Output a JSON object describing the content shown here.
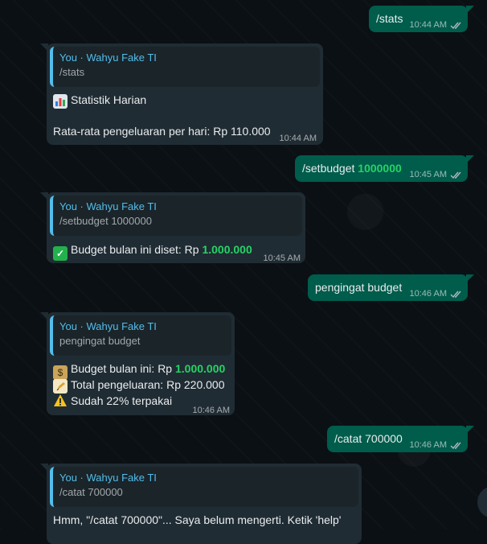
{
  "chat": {
    "messages": [
      {
        "id": "m1",
        "dir": "out",
        "text": "/stats",
        "time": "10:44 AM"
      },
      {
        "id": "m2",
        "dir": "in",
        "quote_author": "You · Wahyu Fake TI",
        "quote_text": "/stats",
        "lines": [
          "Statistik Harian",
          "Rata-rata pengeluaran per hari: Rp 110.000"
        ],
        "emojis": [
          "bar-chart-icon"
        ],
        "time": "10:44 AM"
      },
      {
        "id": "m3",
        "dir": "out",
        "text": "/setbudget ",
        "text_highlight": "1000000",
        "time": "10:45 AM"
      },
      {
        "id": "m4",
        "dir": "in",
        "quote_author": "You · Wahyu Fake TI",
        "quote_text": "/setbudget 1000000",
        "line_prefix": "Budget bulan ini diset: Rp ",
        "line_highlight": "1.000.000",
        "emojis": [
          "check-mark-icon"
        ],
        "time": "10:45 AM"
      },
      {
        "id": "m5",
        "dir": "out",
        "text": "pengingat budget",
        "time": "10:46 AM"
      },
      {
        "id": "m6",
        "dir": "in",
        "quote_author": "You · Wahyu Fake TI",
        "quote_text": "pengingat budget",
        "line1_prefix": "Budget bulan ini: Rp ",
        "line1_highlight": "1.000.000",
        "line2": "Total pengeluaran: Rp 220.000",
        "line3": "Sudah 22% terpakai",
        "emojis": [
          "money-bag-icon",
          "memo-icon",
          "warning-icon"
        ],
        "time": "10:46 AM"
      },
      {
        "id": "m7",
        "dir": "out",
        "text": "/catat 700000",
        "time": "10:46 AM"
      },
      {
        "id": "m8",
        "dir": "in",
        "quote_author": "You · Wahyu Fake TI",
        "quote_text": "/catat 700000",
        "text": "Hmm, \"/catat 700000\"... Saya belum mengerti. Ketik 'help'"
      }
    ]
  },
  "colors": {
    "outgoing_bubble": "#005c4b",
    "incoming_bubble": "#202c33",
    "quote_accent": "#53bdeb",
    "highlight": "#25d366"
  }
}
